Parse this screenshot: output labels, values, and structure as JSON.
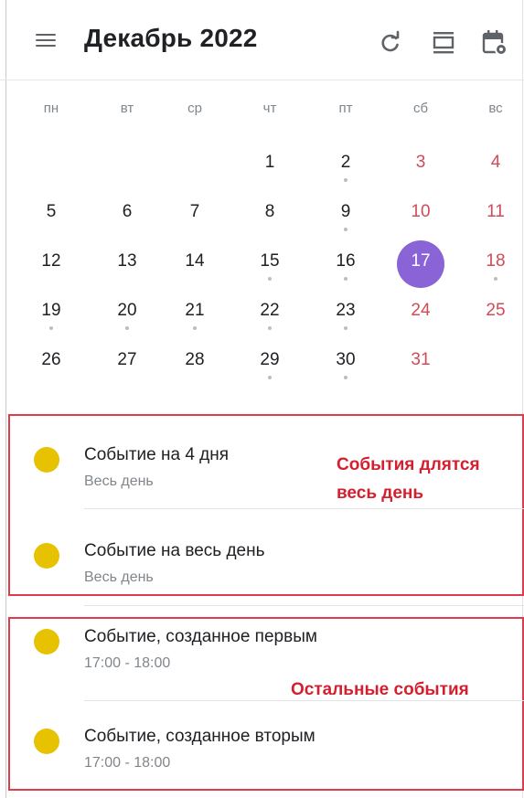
{
  "header": {
    "title": "Декабрь 2022",
    "icons": [
      "menu-icon",
      "refresh-icon",
      "view-toggle-icon",
      "calendar-settings-icon"
    ]
  },
  "calendar": {
    "weekdays": [
      "пн",
      "вт",
      "ср",
      "чт",
      "пт",
      "сб",
      "вс"
    ],
    "weeks": [
      [
        null,
        null,
        null,
        {
          "d": "1"
        },
        {
          "d": "2",
          "dot": true
        },
        {
          "d": "3",
          "we": true
        },
        {
          "d": "4",
          "we": true
        }
      ],
      [
        {
          "d": "5"
        },
        {
          "d": "6"
        },
        {
          "d": "7"
        },
        {
          "d": "8"
        },
        {
          "d": "9",
          "dot": true
        },
        {
          "d": "10",
          "we": true
        },
        {
          "d": "11",
          "we": true
        }
      ],
      [
        {
          "d": "12"
        },
        {
          "d": "13"
        },
        {
          "d": "14"
        },
        {
          "d": "15",
          "dot": true
        },
        {
          "d": "16",
          "dot": true
        },
        {
          "d": "17",
          "we": true,
          "today": true
        },
        {
          "d": "18",
          "we": true,
          "dot": true
        }
      ],
      [
        {
          "d": "19",
          "dot": true
        },
        {
          "d": "20",
          "dot": true
        },
        {
          "d": "21",
          "dot": true
        },
        {
          "d": "22",
          "dot": true
        },
        {
          "d": "23",
          "dot": true
        },
        {
          "d": "24",
          "we": true
        },
        {
          "d": "25",
          "we": true
        }
      ],
      [
        {
          "d": "26"
        },
        {
          "d": "27"
        },
        {
          "d": "28"
        },
        {
          "d": "29",
          "dot": true
        },
        {
          "d": "30",
          "dot": true
        },
        {
          "d": "31",
          "we": true
        },
        null
      ]
    ],
    "colors": {
      "weekend": "#d14b57",
      "today": "#8a64d6",
      "dot": "#bdbdbd"
    }
  },
  "events": {
    "all_day": [
      {
        "title": "Событие на 4 дня",
        "time": "Весь день"
      },
      {
        "title": "Событие на весь день",
        "time": "Весь день"
      }
    ],
    "other": [
      {
        "title": "Событие, созданное первым",
        "time": "17:00 - 18:00"
      },
      {
        "title": "Событие, созданное вторым",
        "time": "17:00 - 18:00"
      }
    ],
    "event_color": "#e6c200"
  },
  "annotations": {
    "all_day_line1": "События длятся",
    "all_day_line2": "весь день",
    "other": "Остальные события",
    "color": "#d51f2f"
  }
}
